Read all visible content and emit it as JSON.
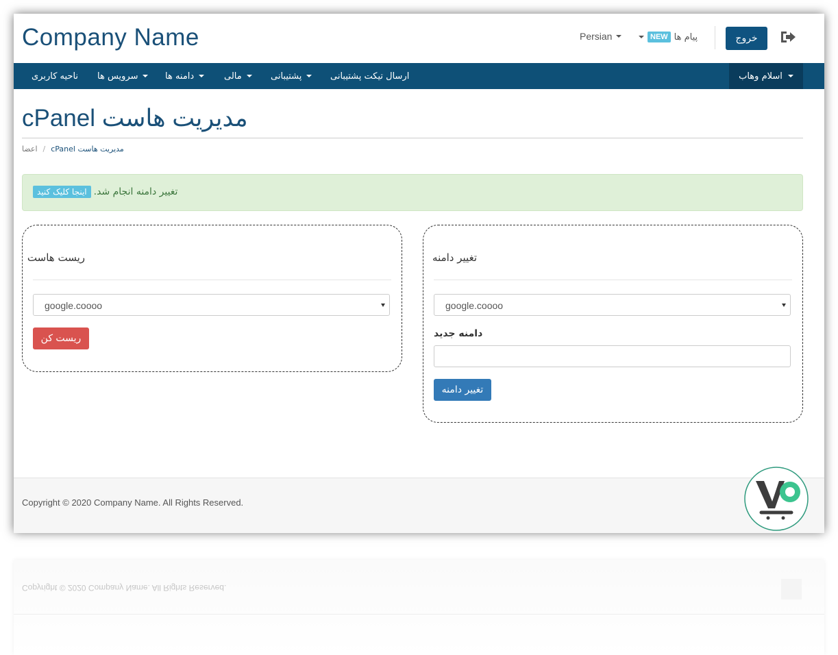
{
  "header": {
    "company_name": "Company Name",
    "language": "Persian",
    "messages_label": "پیام ها",
    "new_badge": "NEW",
    "logout_label": "خروج"
  },
  "navbar": {
    "items": [
      {
        "label": "ناحیه کاربری"
      },
      {
        "label": "سرویس ها"
      },
      {
        "label": "دامنه ها"
      },
      {
        "label": "مالی"
      },
      {
        "label": "پشتیبانی"
      },
      {
        "label": "ارسال تیکت پشتیبانی"
      }
    ],
    "user_label": "اسلام وهاب"
  },
  "page": {
    "title": "cPanel مدیریت هاست",
    "breadcrumb": {
      "home": "اعضا",
      "separator": "/",
      "current": "cPanel مدیریت هاست"
    }
  },
  "alert": {
    "message": ".تغییر دامنه انجام شد",
    "link_label": "اینجا کلیک کنید"
  },
  "reset_panel": {
    "title": "ریست هاست",
    "selected_domain": "google.coooo",
    "button_label": "ریست کن"
  },
  "change_panel": {
    "title": "تغییر دامنه",
    "selected_domain": "google.coooo",
    "new_domain_label": "دامنه جدید",
    "new_domain_value": "",
    "button_label": "تغییر دامنه"
  },
  "footer": {
    "copyright": "Copyright © 2020 Company Name. All Rights Reserved."
  },
  "colors": {
    "primary_dark": "#0e5077",
    "title_blue": "#1a5078",
    "success_bg": "#dff0d8",
    "danger": "#d9534f",
    "primary": "#337ab7",
    "info": "#5bc0de"
  }
}
